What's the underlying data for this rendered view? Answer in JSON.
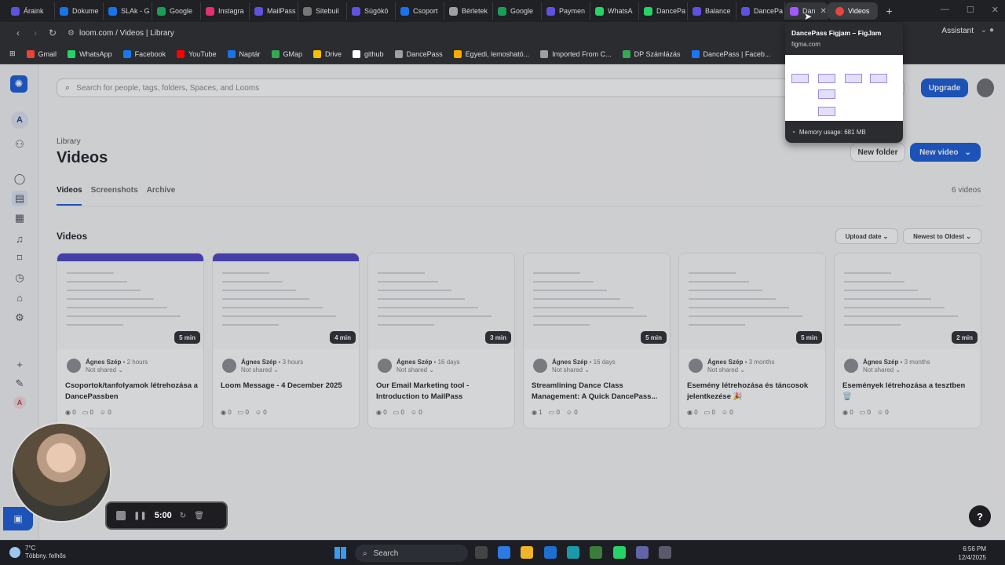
{
  "browser": {
    "tabs": [
      {
        "label": "Áraink",
        "color": "#5e52e0"
      },
      {
        "label": "Dokume",
        "color": "#1a73e8"
      },
      {
        "label": "SLAk - G",
        "color": "#1a73e8"
      },
      {
        "label": "Google",
        "color": "#1a9e55"
      },
      {
        "label": "Instagra",
        "color": "#e1306c"
      },
      {
        "label": "MailPass",
        "color": "#5e52e0"
      },
      {
        "label": "Sitebuil",
        "color": "#777777"
      },
      {
        "label": "Súgókö",
        "color": "#5e52e0"
      },
      {
        "label": "Csoport",
        "color": "#1a73e8"
      },
      {
        "label": "Bérletek",
        "color": "#9aa0a6"
      },
      {
        "label": "Google",
        "color": "#1a9e55"
      },
      {
        "label": "Paymen",
        "color": "#5e52e0"
      },
      {
        "label": "WhatsA",
        "color": "#25d366"
      },
      {
        "label": "DancePa",
        "color": "#25d366"
      },
      {
        "label": "Balance",
        "color": "#5e52e0"
      },
      {
        "label": "DancePa",
        "color": "#5e52e0"
      },
      {
        "label": "Dan",
        "color": "#a259ff"
      }
    ],
    "active_tab": {
      "label": "Videos",
      "color": "#e8453c"
    },
    "url": "loom.com / Videos | Library",
    "assistant_label": "Assistant",
    "bookmarks": [
      {
        "label": "Gmail",
        "color": "#ea4335"
      },
      {
        "label": "WhatsApp",
        "color": "#25d366"
      },
      {
        "label": "Facebook",
        "color": "#1877f2"
      },
      {
        "label": "YouTube",
        "color": "#ff0000"
      },
      {
        "label": "Naptár",
        "color": "#1a73e8"
      },
      {
        "label": "GMap",
        "color": "#34a853"
      },
      {
        "label": "Drive",
        "color": "#fbbc04"
      },
      {
        "label": "github",
        "color": "#ffffff"
      },
      {
        "label": "DancePass",
        "color": "#9aa0a6"
      },
      {
        "label": "Egyedi, lemosható...",
        "color": "#f9ab00"
      },
      {
        "label": "Imported From C...",
        "color": "#9aa0a6"
      },
      {
        "label": "DP Számlázás",
        "color": "#34a853"
      },
      {
        "label": "DancePass | Faceb...",
        "color": "#1877f2"
      }
    ]
  },
  "tab_preview": {
    "title": "DancePass Figjam – FigJam",
    "domain": "figma.com",
    "memory": "Memory usage: 681 MB"
  },
  "loom": {
    "search_placeholder": "Search for people, tags, folders, Spaces, and Looms",
    "upgrade_label": "Upgrade",
    "breadcrumb": "Library",
    "page_title": "Videos",
    "new_folder_label": "New folder",
    "new_video_label": "New video",
    "tabs": [
      "Videos",
      "Screenshots",
      "Archive"
    ],
    "video_count": "6 videos",
    "section_title": "Videos",
    "sort_field": "Upload date",
    "sort_order": "Newest to Oldest",
    "videos": [
      {
        "duration": "5 min",
        "author": "Ágnes Szép",
        "ago": "• 2 hours",
        "shared": "Not shared",
        "title": "Csoportok/tanfolyamok létrehozása a DancePassben",
        "views": "0",
        "comments": "0",
        "reactions": "0"
      },
      {
        "duration": "4 min",
        "author": "Ágnes Szép",
        "ago": "• 3 hours",
        "shared": "Not shared",
        "title": "Loom Message - 4 December 2025",
        "views": "0",
        "comments": "0",
        "reactions": "0"
      },
      {
        "duration": "3 min",
        "author": "Ágnes Szép",
        "ago": "• 16 days",
        "shared": "Not shared",
        "title": "Our Email Marketing tool - Introduction to MailPass",
        "views": "0",
        "comments": "0",
        "reactions": "0"
      },
      {
        "duration": "5 min",
        "author": "Ágnes Szép",
        "ago": "• 16 days",
        "shared": "Not shared",
        "title": "Streamlining Dance Class Management: A Quick DancePass...",
        "views": "1",
        "comments": "0",
        "reactions": "0"
      },
      {
        "duration": "5 min",
        "author": "Ágnes Szép",
        "ago": "• 3 months",
        "shared": "Not shared",
        "title": "Esemény létrehozása és táncosok jelentkezése 🎉",
        "views": "0",
        "comments": "0",
        "reactions": "0"
      },
      {
        "duration": "2 min",
        "author": "Ágnes Szép",
        "ago": "• 3 months",
        "shared": "Not shared",
        "title": "Események létrehozása a tesztben 🗑️",
        "views": "0",
        "comments": "0",
        "reactions": "0"
      }
    ]
  },
  "recorder": {
    "time": "5:00"
  },
  "taskbar": {
    "temp": "7°C",
    "weather": "Többny. felhős",
    "search_label": "Search",
    "time": "6:56 PM",
    "date": "12/4/2025"
  }
}
